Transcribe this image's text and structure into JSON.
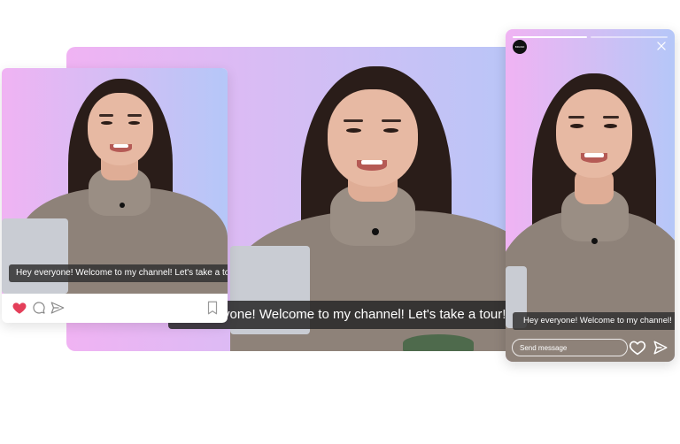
{
  "captions": {
    "wide": "Hey everyone! Welcome to my channel! Let's take a tour!",
    "feed": "Hey everyone! Welcome to my channel! Let's take a tour!",
    "story": "Hey everyone! Welcome to my channel!"
  },
  "feed_card": {
    "actions": [
      "heart-icon",
      "comment-icon",
      "share-icon",
      "bookmark-icon"
    ],
    "liked": true,
    "colors": {
      "heart": "#e43f5a"
    }
  },
  "story_card": {
    "avatar_text": "BRAND",
    "progress": [
      1,
      0
    ],
    "input_placeholder": "Send message",
    "actions": [
      "close-icon",
      "heart-icon",
      "send-icon"
    ]
  },
  "colors": {
    "gradient_left": "#f0b3f3",
    "gradient_right": "#b5c7f8",
    "caption_bg": "#282828"
  }
}
